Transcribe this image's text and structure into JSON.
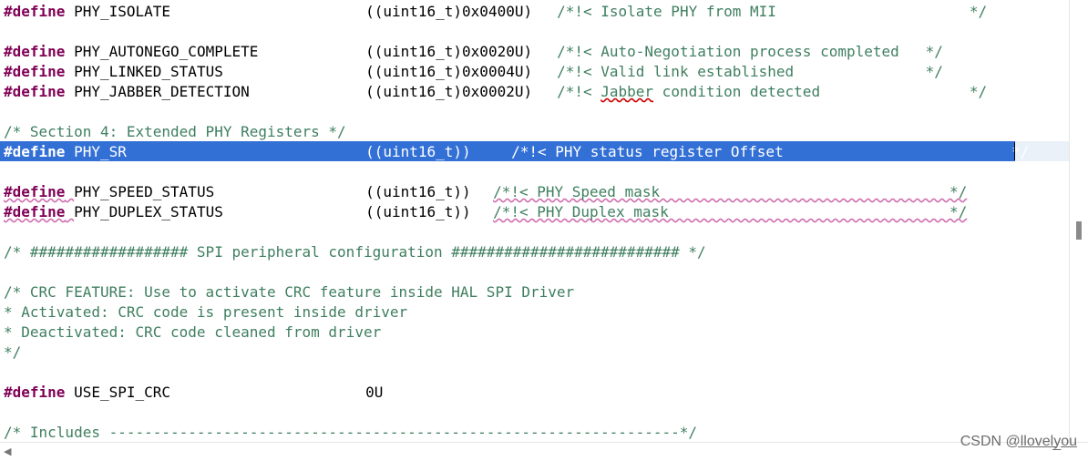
{
  "editor": {
    "lines": [
      {
        "kw": "#define",
        "name": "PHY_ISOLATE",
        "value": "((uint16_t)0x0400U)",
        "comment": "/*!< Isolate PHY from MII                      */"
      },
      {
        "kw": "#define",
        "name": "PHY_AUTONEGO_COMPLETE",
        "value": "((uint16_t)0x0020U)",
        "comment": "/*!< Auto-Negotiation process completed   */"
      },
      {
        "kw": "#define",
        "name": "PHY_LINKED_STATUS",
        "value": "((uint16_t)0x0004U)",
        "comment": "/*!< Valid link established               */"
      },
      {
        "kw": "#define",
        "name": "PHY_JABBER_DETECTION",
        "value": "((uint16_t)0x0002U)",
        "comment_pre": "/*!< ",
        "comment_word": "Jabber",
        "comment_post": " condition detected                 */"
      },
      {
        "text": "/* Section 4: Extended PHY Registers */"
      },
      {
        "kw": "#define",
        "name": "PHY_SR",
        "value": "((uint16_t))",
        "comment": "/*!< PHY status register Offset                          */"
      },
      {
        "kw": "#define",
        "name": "PHY_SPEED_STATUS",
        "value": "((uint16_t))",
        "comment": "/*!< PHY Speed mask                                 */"
      },
      {
        "kw": "#define",
        "name": "PHY_DUPLEX_STATUS",
        "value": "((uint16_t))",
        "comment": "/*!< PHY Duplex mask                                */"
      },
      {
        "text": "/* ################## SPI peripheral configuration ########################## */"
      },
      {
        "text": "/* CRC FEATURE: Use to activate CRC feature inside HAL SPI Driver"
      },
      {
        "text": "* Activated: CRC code is present inside driver"
      },
      {
        "text": "* Deactivated: CRC code cleaned from driver"
      },
      {
        "text": "*/"
      },
      {
        "kw": "#define",
        "name": "USE_SPI_CRC",
        "value": "0U"
      },
      {
        "text": "/* Includes -----------------------------------------------------------------*/"
      }
    ]
  },
  "watermark": "CSDN @l̲l̲o̲v̲e̲l̲y̲o̲u̲"
}
